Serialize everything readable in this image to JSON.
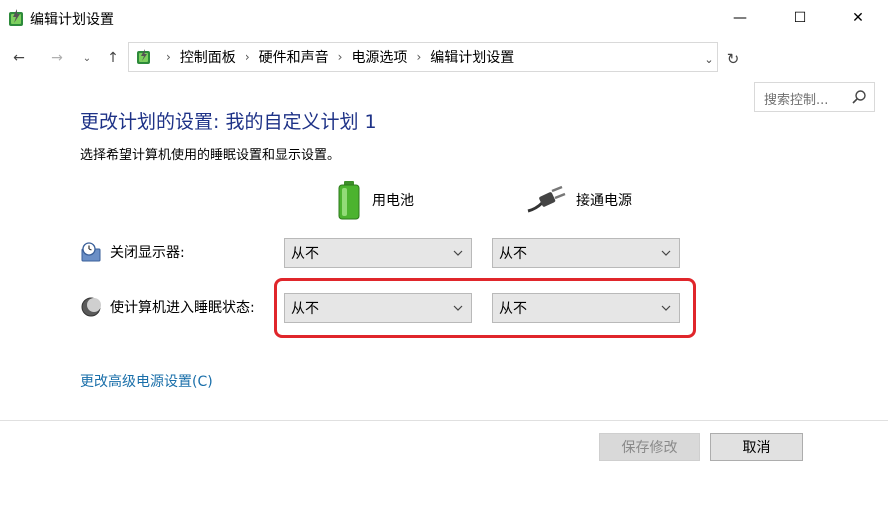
{
  "window": {
    "title": "编辑计划设置",
    "minimize_glyph": "—",
    "maximize_glyph": "☐",
    "close_glyph": "✕"
  },
  "nav": {
    "back_glyph": "←",
    "forward_glyph": "→",
    "recent_glyph": "⌄",
    "up_glyph": "↑",
    "breadcrumbs": [
      "控制面板",
      "硬件和声音",
      "电源选项",
      "编辑计划设置"
    ],
    "separator": "›",
    "dropdown_glyph": "⌄",
    "refresh_glyph": "↻",
    "search_placeholder": "搜索控制..."
  },
  "main": {
    "heading": "更改计划的设置: 我的自定义计划 1",
    "subtitle": "选择希望计算机使用的睡眠设置和显示设置。",
    "columns": {
      "battery": "用电池",
      "ac": "接通电源"
    },
    "rows": [
      {
        "label": "关闭显示器:",
        "battery_value": "从不",
        "ac_value": "从不",
        "icon": "display-timer-icon"
      },
      {
        "label": "使计算机进入睡眠状态:",
        "battery_value": "从不",
        "ac_value": "从不",
        "icon": "sleep-moon-icon"
      }
    ],
    "advanced_link": "更改高级电源设置(C)"
  },
  "footer": {
    "save_label": "保存修改",
    "cancel_label": "取消"
  },
  "colors": {
    "heading": "#1e3287",
    "link": "#1a6faa",
    "highlight": "#e0262b",
    "battery_green": "#4cb32f"
  }
}
